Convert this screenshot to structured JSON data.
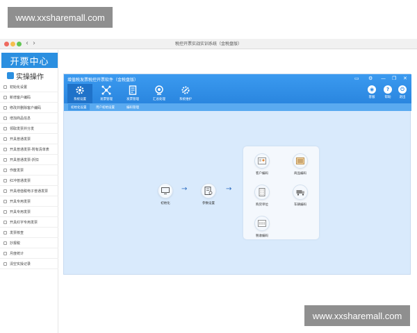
{
  "watermark": {
    "text": "www.xxsharemall.com"
  },
  "window": {
    "title": "税控开票实战实训系统（金税盘版）",
    "colors": {
      "close": "#ee6a5f",
      "min": "#f5be4f",
      "max": "#62c554"
    }
  },
  "sidebar": {
    "brand": "开票中心",
    "ops_title": "实操操作",
    "items": [
      {
        "label": "初始化设置"
      },
      {
        "label": "新增客户编码"
      },
      {
        "label": "修改并删除客户编码"
      },
      {
        "label": "增加商品信息"
      },
      {
        "label": "领取发票并分发"
      },
      {
        "label": "开具普通发票"
      },
      {
        "label": "开具普通发票-附有清单表"
      },
      {
        "label": "开具普通发票-折扣"
      },
      {
        "label": "作废发票"
      },
      {
        "label": "红冲普通发票"
      },
      {
        "label": "开具增值税电子普通发票"
      },
      {
        "label": "开具专用发票"
      },
      {
        "label": "开具专用发票"
      },
      {
        "label": "开具红字专用发票"
      },
      {
        "label": "发票核查"
      },
      {
        "label": "抄报税"
      },
      {
        "label": "月度统计"
      },
      {
        "label": "清空实操记录"
      }
    ]
  },
  "app": {
    "title": "增值税发票税控开票软件（金税盘版）",
    "toolbar": [
      {
        "label": "系统设置",
        "icon": "gear-icon"
      },
      {
        "label": "发票管理",
        "icon": "network-icon"
      },
      {
        "label": "发票管理",
        "icon": "invoice-doc-icon"
      },
      {
        "label": "汇总处理",
        "icon": "summary-icon"
      },
      {
        "label": "系统维护",
        "icon": "wrench-gear-icon"
      }
    ],
    "right_buttons": [
      {
        "label": "客服",
        "glyph": "◉"
      },
      {
        "label": "帮助",
        "glyph": "?"
      },
      {
        "label": "退出",
        "glyph": "⏻"
      }
    ],
    "subtabs": [
      {
        "label": "初始化设置"
      },
      {
        "label": "用户初始设置"
      },
      {
        "label": "编码管理"
      }
    ],
    "flow": {
      "step1": "初始化",
      "step2": "参数设置",
      "panel_items": [
        {
          "label": "客户编码"
        },
        {
          "label": "商品编码"
        },
        {
          "label": "购货单位"
        },
        {
          "label": "车辆编码"
        },
        {
          "label": "税收编码"
        }
      ]
    },
    "colors": {
      "header": "#2a86df",
      "body": "#d9eafc",
      "accent": "#2b8fe0"
    }
  }
}
